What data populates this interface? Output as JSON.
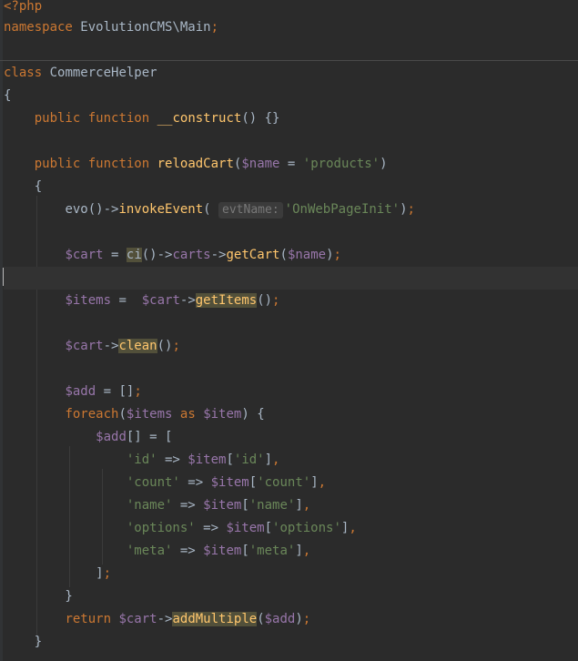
{
  "editor": {
    "colors": {
      "background": "#2b2b2b",
      "keyword": "#cc7832",
      "string": "#6a8759",
      "variable": "#9876aa",
      "function": "#ffc66d",
      "default": "#a9b7c6",
      "highlight": "#52503a"
    },
    "open_tag": "<?php",
    "namespace_kw": "namespace",
    "namespace_name": " EvolutionCMS\\Main",
    "class_kw": "class",
    "class_name": " CommerceHelper",
    "public": "public",
    "function": "function",
    "construct_name": "__construct",
    "reload_name": "reloadCart",
    "name_var": "$name",
    "products_str": "'products'",
    "evo": "evo",
    "invoke_event": "invokeEvent",
    "hint_label": "evtName:",
    "event_str": "'OnWebPageInit'",
    "cart_var": "$cart",
    "ci": "ci",
    "carts": "carts",
    "get_cart": "getCart",
    "items_var": "$items",
    "get_items": "getItems",
    "clean": "clean",
    "add_var": "$add",
    "foreach": "foreach",
    "as": "as",
    "item_var": "$item",
    "keys": {
      "id": "'id'",
      "count": "'count'",
      "name": "'name'",
      "options": "'options'",
      "meta": "'meta'"
    },
    "return": "return",
    "add_multiple": "addMultiple"
  }
}
